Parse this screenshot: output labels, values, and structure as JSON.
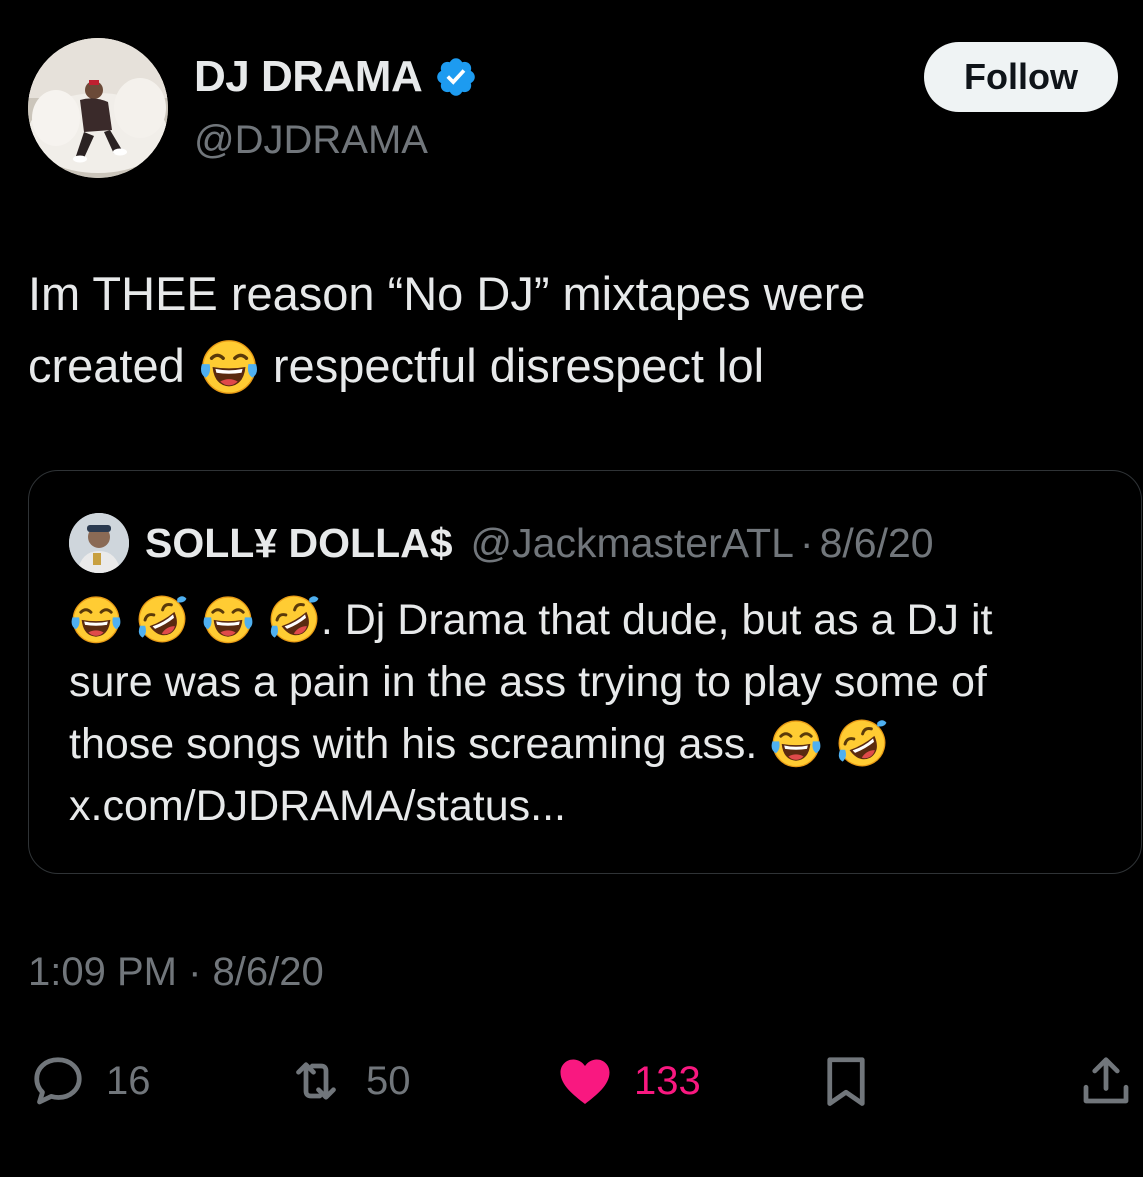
{
  "author": {
    "display_name": "DJ DRAMA",
    "handle": "@DJDRAMA",
    "verified": true
  },
  "follow_label": "Follow",
  "tweet": {
    "line1": "Im THEE reason “No DJ” mixtapes were",
    "line2_pre": "created",
    "line2_post": "respectful disrespect lol",
    "emoji": "face-with-tears-of-joy"
  },
  "quoted_tweet": {
    "display_name": "SOLL¥ DOLLA$",
    "handle": "@JackmasterATL",
    "separator": "·",
    "date": "8/6/20",
    "line1_post": ". Dj Drama that dude, but as a DJ it",
    "line2": "sure was a pain in the ass trying to play some of",
    "line3": "those songs with his screaming ass.",
    "line4": "x.com/DJDRAMA/status..."
  },
  "timestamp": {
    "time": "1:09 PM",
    "separator": "·",
    "date": "8/6/20"
  },
  "actions": {
    "replies": "16",
    "reposts": "50",
    "likes": "133"
  },
  "colors": {
    "background": "#000000",
    "text": "#e7e9ea",
    "secondary": "#71767b",
    "verified": "#1d9bf0",
    "like": "#f91880",
    "border": "#2f3336"
  }
}
